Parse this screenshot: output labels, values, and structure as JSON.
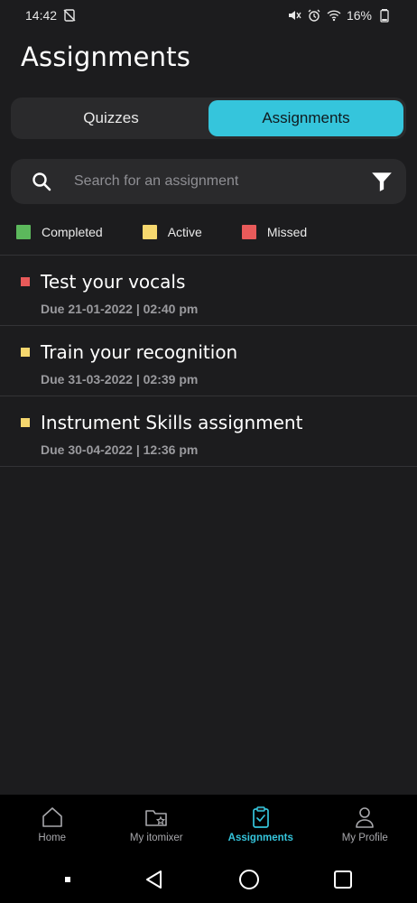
{
  "status_bar": {
    "time": "14:42",
    "battery": "16%",
    "icons": [
      "dnd-off-icon",
      "mute-icon",
      "alarm-icon",
      "wifi-icon",
      "battery-icon"
    ]
  },
  "page": {
    "title": "Assignments"
  },
  "tabs": [
    {
      "label": "Quizzes",
      "active": false
    },
    {
      "label": "Assignments",
      "active": true
    }
  ],
  "search": {
    "placeholder": "Search for an assignment",
    "value": ""
  },
  "legend": [
    {
      "label": "Completed",
      "color": "#5cb85c"
    },
    {
      "label": "Active",
      "color": "#f5d76e"
    },
    {
      "label": "Missed",
      "color": "#e85a5a"
    }
  ],
  "assignments": [
    {
      "title": "Test your vocals",
      "due": "Due 21-01-2022 | 02:40 pm",
      "status": "Missed",
      "color": "#e85a5a"
    },
    {
      "title": "Train your recognition",
      "due": "Due 31-03-2022 | 02:39 pm",
      "status": "Active",
      "color": "#f5d76e"
    },
    {
      "title": "Instrument Skills assignment",
      "due": "Due 30-04-2022 | 12:36 pm",
      "status": "Active",
      "color": "#f5d76e"
    }
  ],
  "bottom_nav": [
    {
      "label": "Home",
      "icon": "home-icon",
      "active": false
    },
    {
      "label": "My itomixer",
      "icon": "folder-star-icon",
      "active": false
    },
    {
      "label": "Assignments",
      "icon": "clipboard-check-icon",
      "active": true
    },
    {
      "label": "My Profile",
      "icon": "profile-icon",
      "active": false
    }
  ],
  "colors": {
    "accent": "#35c5dc",
    "background": "#1c1c1e",
    "surface": "#2a2a2c"
  }
}
